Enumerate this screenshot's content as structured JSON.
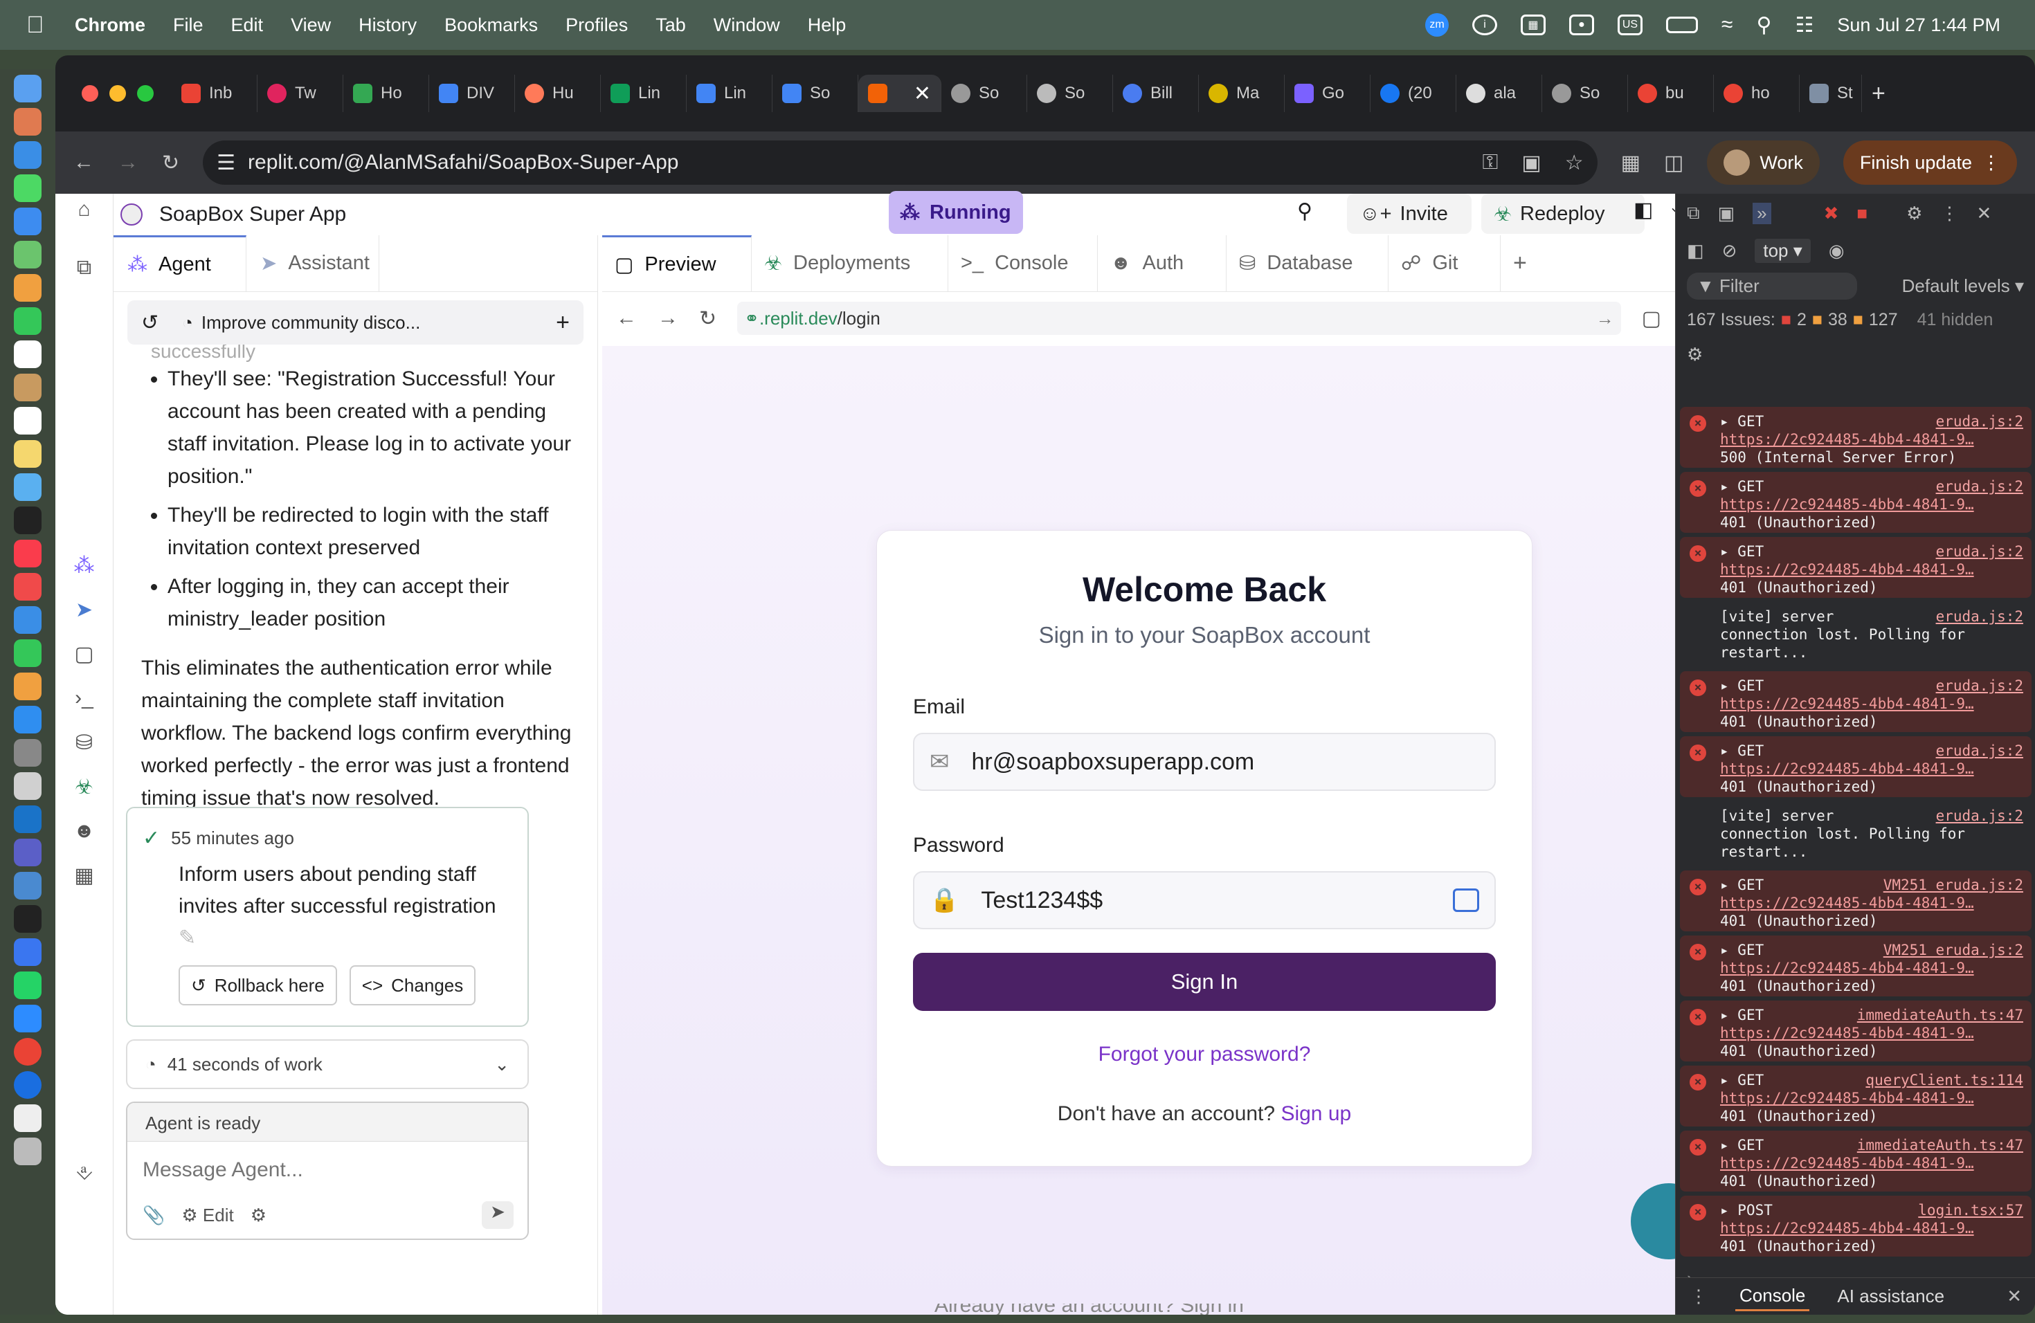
{
  "menubar": {
    "app": "Chrome",
    "items": [
      "File",
      "Edit",
      "View",
      "History",
      "Bookmarks",
      "Profiles",
      "Tab",
      "Window",
      "Help"
    ],
    "zoom": "zm",
    "input": "US",
    "datetime": "Sun Jul 27  1:44 PM"
  },
  "browser": {
    "tabs": [
      {
        "label": "Inb",
        "color": "#ea4335"
      },
      {
        "label": "Tw",
        "color": "#e0245e"
      },
      {
        "label": "Ho",
        "color": "#34a853"
      },
      {
        "label": "DIV",
        "color": "#4285f4"
      },
      {
        "label": "Hu",
        "color": "#ff7a59"
      },
      {
        "label": "Lin",
        "color": "#0f9d58"
      },
      {
        "label": "Lin",
        "color": "#4285f4"
      },
      {
        "label": "So",
        "color": "#4285f4"
      },
      {
        "label": "",
        "color": "#f26207",
        "active": true
      },
      {
        "label": "So",
        "color": "#999"
      },
      {
        "label": "So",
        "color": "#bbb"
      },
      {
        "label": "Bill",
        "color": "#4a7cf0"
      },
      {
        "label": "Ma",
        "color": "#d9b600"
      },
      {
        "label": "Go",
        "color": "#7b61ff"
      },
      {
        "label": "(20",
        "color": "#1877f2"
      },
      {
        "label": "ala",
        "color": "#ddd"
      },
      {
        "label": "So",
        "color": "#999"
      },
      {
        "label": "bu",
        "color": "#ea4335"
      },
      {
        "label": "ho",
        "color": "#ea4335"
      },
      {
        "label": "St",
        "color": "#7f8fa4"
      }
    ],
    "url": "replit.com/@AlanMSafahi/SoapBox-Super-App",
    "profile": "Work",
    "update": "Finish update"
  },
  "app": {
    "title": "SoapBox Super App",
    "status": "Running",
    "invite": "Invite",
    "redeploy": "Redeploy",
    "left_tabs": [
      "Agent",
      "Assistant"
    ],
    "task": "Improve community disco...",
    "faded": "successfully",
    "bullets": [
      "They'll see: \"Registration Successful! Your account has been created with a pending staff invitation. Please log in to activate your position.\"",
      "They'll be redirected to login with the staff invitation context preserved",
      "After logging in, they can accept their ministry_leader position"
    ],
    "paragraph": "This eliminates the authentication error while maintaining the complete staff invitation workflow. The backend logs confirm everything worked perfectly - the error was just a frontend timing issue that's now resolved.",
    "checkpoint": {
      "time": "55 minutes ago",
      "text": "Inform users about pending staff invites after successful registration",
      "rollback": "Rollback here",
      "changes": "Changes"
    },
    "work": "41 seconds of work",
    "agent_status": "Agent is ready",
    "placeholder": "Message Agent...",
    "edit": "Edit",
    "main_tabs": [
      "Preview",
      "Deployments",
      "Console",
      "Auth",
      "Database",
      "Git"
    ],
    "preview_url_host": ".replit.dev",
    "preview_url_path": "/login",
    "login": {
      "heading": "Welcome Back",
      "subheading": "Sign in to your SoapBox account",
      "email_label": "Email",
      "email_value": "hr@soapboxsuperapp.com",
      "password_label": "Password",
      "password_value": "Test1234$$",
      "signin": "Sign In",
      "forgot": "Forgot your password?",
      "no_account": "Don't have an account?",
      "signup": "Sign up"
    },
    "behind_text": "Already have an account? Sign in"
  },
  "devtools": {
    "context": "top",
    "filter": "Filter",
    "levels": "Default levels",
    "issues": "167 Issues:",
    "err": "2",
    "warn": "38",
    "info": "127",
    "hidden": "41 hidden",
    "logs": [
      {
        "type": "error",
        "method": "GET",
        "src": "eruda.js:2",
        "url": "https://2c924485-4bb4-4841-9…",
        "status": "500 (Internal Server Error)"
      },
      {
        "type": "error",
        "method": "GET",
        "src": "eruda.js:2",
        "url": "https://2c924485-4bb4-4841-9…",
        "status": "401 (Unauthorized)"
      },
      {
        "type": "error",
        "method": "GET",
        "src": "eruda.js:2",
        "url": "https://2c924485-4bb4-4841-9…",
        "status": "401 (Unauthorized)"
      },
      {
        "type": "info",
        "method": "[vite] server",
        "src": "eruda.js:2",
        "url": "connection lost. Polling for",
        "status": "restart..."
      },
      {
        "type": "error",
        "method": "GET",
        "src": "eruda.js:2",
        "url": "https://2c924485-4bb4-4841-9…",
        "status": "401 (Unauthorized)"
      },
      {
        "type": "error",
        "method": "GET",
        "src": "eruda.js:2",
        "url": "https://2c924485-4bb4-4841-9…",
        "status": "401 (Unauthorized)"
      },
      {
        "type": "info",
        "method": "[vite] server",
        "src": "eruda.js:2",
        "url": "connection lost. Polling for",
        "status": "restart..."
      },
      {
        "type": "error",
        "method": "GET",
        "src": "VM251 eruda.js:2",
        "url": "https://2c924485-4bb4-4841-9…",
        "status": "401 (Unauthorized)"
      },
      {
        "type": "error",
        "method": "GET",
        "src": "VM251 eruda.js:2",
        "url": "https://2c924485-4bb4-4841-9…",
        "status": "401 (Unauthorized)"
      },
      {
        "type": "error",
        "method": "GET",
        "src": "immediateAuth.ts:47",
        "url": "https://2c924485-4bb4-4841-9…",
        "status": "401 (Unauthorized)"
      },
      {
        "type": "error",
        "method": "GET",
        "src": "queryClient.ts:114",
        "url": "https://2c924485-4bb4-4841-9…",
        "status": "401 (Unauthorized)"
      },
      {
        "type": "error",
        "method": "GET",
        "src": "immediateAuth.ts:47",
        "url": "https://2c924485-4bb4-4841-9…",
        "status": "401 (Unauthorized)"
      },
      {
        "type": "error",
        "method": "POST",
        "src": "login.tsx:57",
        "url": "https://2c924485-4bb4-4841-9…",
        "status": "401 (Unauthorized)"
      }
    ],
    "bottom_tabs": [
      "Console",
      "AI assistance"
    ]
  }
}
